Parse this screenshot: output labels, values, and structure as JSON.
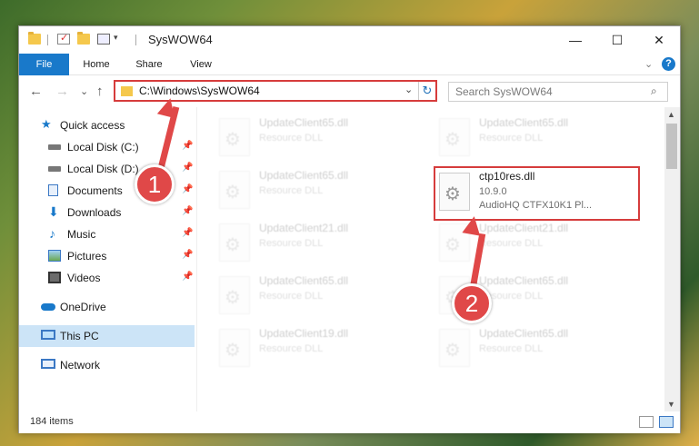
{
  "window": {
    "title": "SysWOW64"
  },
  "window_controls": {
    "minimize": "—",
    "maximize": "☐",
    "close": "✕"
  },
  "ribbon": {
    "tabs": [
      "File",
      "Home",
      "Share",
      "View"
    ],
    "collapse_icon": "⌄",
    "help_icon": "?"
  },
  "nav": {
    "back_icon": "←",
    "forward_icon": "→",
    "recent_icon": "⌄",
    "up_icon": "↑",
    "address": "C:\\Windows\\SysWOW64",
    "address_dropdown_icon": "⌄",
    "refresh_icon": "↻",
    "search_placeholder": "Search SysWOW64",
    "search_icon": "⌕"
  },
  "sidebar": {
    "items": [
      {
        "label": "Quick access",
        "icon": "star-icon",
        "pinned": false
      },
      {
        "label": "Local Disk (C:)",
        "icon": "drive-icon",
        "pinned": true
      },
      {
        "label": "Local Disk (D:)",
        "icon": "drive-icon",
        "pinned": true
      },
      {
        "label": "Documents",
        "icon": "documents-icon",
        "pinned": true
      },
      {
        "label": "Downloads",
        "icon": "downloads-icon",
        "pinned": true
      },
      {
        "label": "Music",
        "icon": "music-icon",
        "pinned": true
      },
      {
        "label": "Pictures",
        "icon": "pictures-icon",
        "pinned": true
      },
      {
        "label": "Videos",
        "icon": "videos-icon",
        "pinned": true
      },
      {
        "label": "OneDrive",
        "icon": "onedrive-icon",
        "pinned": false
      },
      {
        "label": "This PC",
        "icon": "computer-icon",
        "pinned": false,
        "selected": true
      },
      {
        "label": "Network",
        "icon": "network-icon",
        "pinned": false
      }
    ],
    "pin_glyph": "📌"
  },
  "files": [
    {
      "name": "UpdateClient65.dll",
      "line2": "Resource DLL",
      "line3": ""
    },
    {
      "name": "UpdateClient65.dll",
      "line2": "Resource DLL",
      "line3": ""
    },
    {
      "name": "UpdateClient65.dll",
      "line2": "Resource DLL",
      "line3": ""
    },
    {
      "name": "ctp10res.dll",
      "line2": "10.9.0",
      "line3": "AudioHQ CTFX10K1 Pl...",
      "highlighted": true
    },
    {
      "name": "UpdateClient21.dll",
      "line2": "Resource DLL",
      "line3": ""
    },
    {
      "name": "UpdateClient21.dll",
      "line2": "Resource DLL",
      "line3": ""
    },
    {
      "name": "UpdateClient65.dll",
      "line2": "Resource DLL",
      "line3": ""
    },
    {
      "name": "UpdateClient65.dll",
      "line2": "Resource DLL",
      "line3": ""
    },
    {
      "name": "UpdateClient19.dll",
      "line2": "Resource DLL",
      "line3": ""
    },
    {
      "name": "UpdateClient65.dll",
      "line2": "Resource DLL",
      "line3": ""
    }
  ],
  "status": {
    "item_count": "184 items"
  },
  "callouts": [
    {
      "label": "1"
    },
    {
      "label": "2"
    }
  ],
  "colors": {
    "accent": "#1979ca",
    "highlight": "#d63c3c",
    "callout": "#e04848",
    "selected_bg": "#cce4f7"
  }
}
